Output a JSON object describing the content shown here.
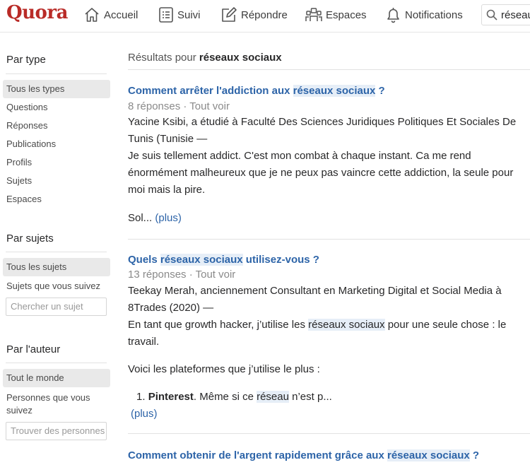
{
  "header": {
    "logo": "Quora",
    "nav": [
      {
        "label": "Accueil",
        "icon": "home-icon"
      },
      {
        "label": "Suivi",
        "icon": "following-list-icon"
      },
      {
        "label": "Répondre",
        "icon": "pencil-square-icon"
      },
      {
        "label": "Espaces",
        "icon": "people-group-icon"
      },
      {
        "label": "Notifications",
        "icon": "bell-icon"
      }
    ],
    "search": {
      "value": "réseau",
      "icon": "search-icon"
    }
  },
  "sidebar": {
    "by_type": {
      "heading": "Par type",
      "items": [
        "Tous les types",
        "Questions",
        "Réponses",
        "Publications",
        "Profils",
        "Sujets",
        "Espaces"
      ],
      "active": "Tous les types"
    },
    "by_topic": {
      "heading": "Par sujets",
      "items": [
        "Tous les sujets",
        "Sujets que vous suivez"
      ],
      "active": "Tous les sujets",
      "search_placeholder": "Chercher un sujet"
    },
    "by_author": {
      "heading": "Par l'auteur",
      "items": [
        "Tout le monde",
        "Personnes que vous suivez"
      ],
      "active": "Tout le monde",
      "search_placeholder": "Trouver des personnes"
    }
  },
  "main": {
    "results_prefix": "Résultats pour ",
    "query": "réseaux sociaux",
    "results": [
      {
        "title_before": "Comment arrêter l'addiction aux ",
        "title_highlight": "réseaux sociaux",
        "title_after": " ?",
        "meta": "8 réponses · Tout voir",
        "author_line": "Yacine Ksibi, a étudié à Faculté Des Sciences Juridiques Politiques Et Sociales De Tunis (Tunisie —",
        "excerpt": "Je suis tellement addict. C'est mon combat à chaque instant. Ca me rend énormément malheureux que je ne peux pas vaincre cette addiction, la seule pour moi mais la pire.",
        "tail": "Sol... ",
        "more": "(plus)"
      },
      {
        "title_before": "Quels ",
        "title_highlight": "réseaux sociaux",
        "title_after": " utilisez-vous ?",
        "meta": "13 réponses · Tout voir",
        "author_line": "Teekay Merah, anciennement Consultant en Marketing Digital et Social Media à 8Trades (2020) —",
        "excerpt_before": "En tant que growth hacker, j’utilise les ",
        "excerpt_highlight": "réseaux sociaux",
        "excerpt_after": " pour une seule chose : le travail.",
        "paragraph": "Voici les plateformes que j’utilise le plus :",
        "list_number": "1.",
        "list_bold": "Pinterest",
        "list_before": ". Même si ce ",
        "list_highlight": "réseau",
        "list_after": " n’est p...",
        "more": "(plus)"
      },
      {
        "title_before": "Comment obtenir de l'argent rapidement grâce aux ",
        "title_highlight": "réseaux sociaux",
        "title_after": " ?"
      }
    ]
  }
}
